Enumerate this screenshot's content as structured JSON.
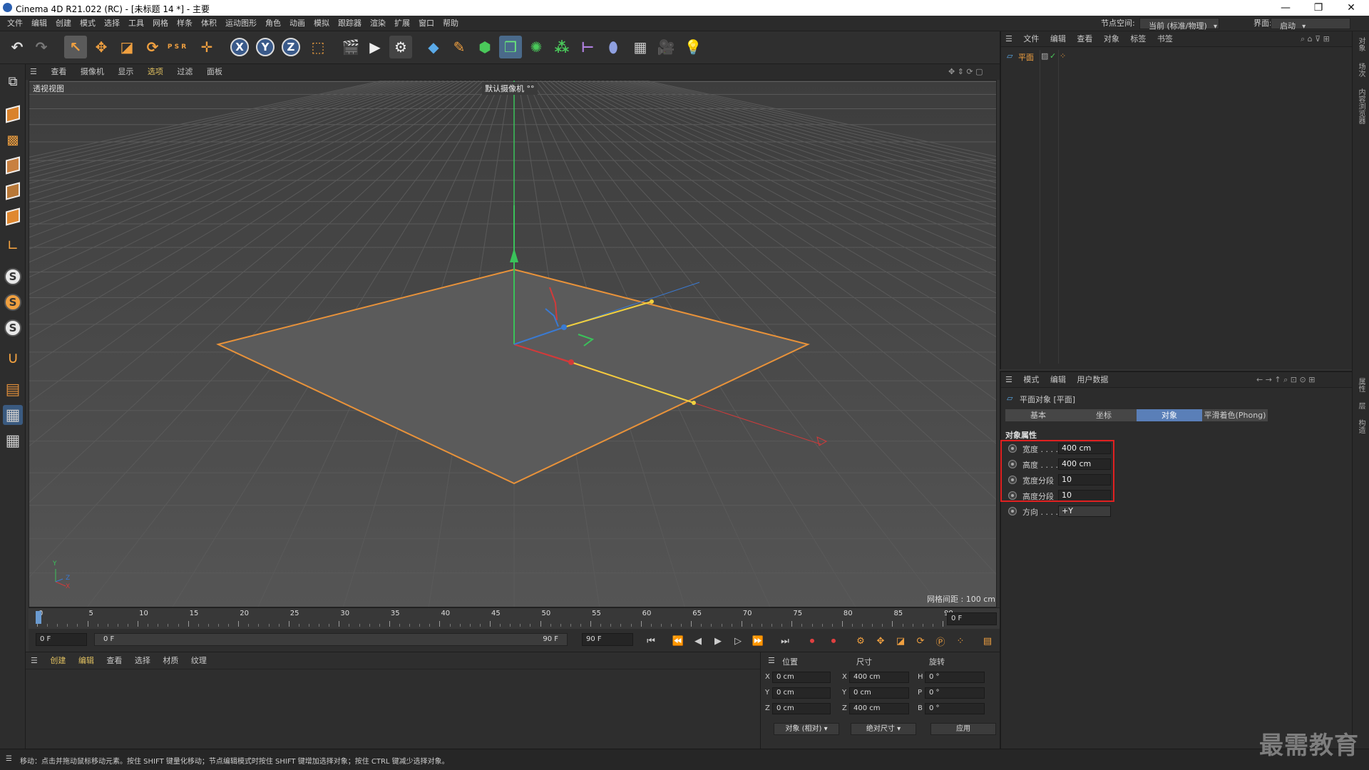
{
  "window": {
    "title": "Cinema 4D R21.022 (RC) - [未标题 14 *] - 主要",
    "controls": [
      "—",
      "❐",
      "✕"
    ]
  },
  "menu": {
    "items": [
      "文件",
      "编辑",
      "创建",
      "模式",
      "选择",
      "工具",
      "网格",
      "样条",
      "体积",
      "运动图形",
      "角色",
      "动画",
      "模拟",
      "跟踪器",
      "渲染",
      "扩展",
      "窗口",
      "帮助"
    ],
    "node_space_label": "节点空间:",
    "node_space_value": "当前 (标准/物理)",
    "layout_label": "界面:",
    "layout_value": "启动"
  },
  "toolbar": {
    "axis_x": "X",
    "axis_y": "Y",
    "axis_z": "Z",
    "psr": "P S R"
  },
  "viewport": {
    "menu": [
      "查看",
      "摄像机",
      "显示",
      "选项",
      "过滤",
      "面板"
    ],
    "view_name": "透视视图",
    "camera": "默认摄像机 °°",
    "grid_spacing": "网格间距 : 100 cm",
    "axis_y": "Y",
    "axis_z": "Z",
    "axis_x": "X"
  },
  "timeline": {
    "ticks": [
      "0",
      "5",
      "10",
      "15",
      "20",
      "25",
      "30",
      "35",
      "40",
      "45",
      "50",
      "55",
      "60",
      "65",
      "70",
      "75",
      "80",
      "85",
      "90"
    ],
    "current_frame": "0 F",
    "start": "0 F",
    "range_start": "0 F",
    "range_end": "90 F",
    "end": "90 F"
  },
  "material_panel": {
    "menu": [
      "创建",
      "编辑",
      "查看",
      "选择",
      "材质",
      "纹理"
    ]
  },
  "coord_panel": {
    "headers": [
      "位置",
      "尺寸",
      "旋转"
    ],
    "rows": [
      {
        "a": "X",
        "pos": "0 cm",
        "b": "X",
        "size": "400 cm",
        "c": "H",
        "rot": "0 °"
      },
      {
        "a": "Y",
        "pos": "0 cm",
        "b": "Y",
        "size": "0 cm",
        "c": "P",
        "rot": "0 °"
      },
      {
        "a": "Z",
        "pos": "0 cm",
        "b": "Z",
        "size": "400 cm",
        "c": "B",
        "rot": "0 °"
      }
    ],
    "mode": "对象 (相对)",
    "size_mode": "绝对尺寸",
    "apply": "应用"
  },
  "object_manager": {
    "menu": [
      "文件",
      "编辑",
      "查看",
      "对象",
      "标签",
      "书签"
    ],
    "object_name": "平面"
  },
  "attributes": {
    "menu": [
      "模式",
      "编辑",
      "用户数据"
    ],
    "title": "平面对象 [平面]",
    "tabs": [
      "基本",
      "坐标",
      "对象",
      "平滑着色(Phong)"
    ],
    "active_tab": "对象",
    "section": "对象属性",
    "fields": [
      {
        "label": "宽度 . . . .",
        "value": "400 cm"
      },
      {
        "label": "高度 . . . .",
        "value": "400 cm"
      },
      {
        "label": "宽度分段",
        "value": "10"
      },
      {
        "label": "高度分段",
        "value": "10"
      },
      {
        "label": "方向 . . . .",
        "value": "+Y"
      }
    ]
  },
  "right_strip": {
    "tabs": [
      "对象",
      "场次",
      "内容浏览器",
      "属性",
      "层",
      "构造"
    ]
  },
  "status": "移动：点击并拖动鼠标移动元素。按住 SHIFT 键量化移动；节点编辑模式时按住 SHIFT 键增加选择对象；按住 CTRL 键减少选择对象。",
  "watermark": "最需教育",
  "colors": {
    "accent": "#5a7fb8",
    "selection_orange": "#e8923a",
    "highlight_box": "#e02020",
    "x_axis": "#d23a3a",
    "y_axis": "#3ac25a",
    "z_axis": "#3a7ad2"
  }
}
